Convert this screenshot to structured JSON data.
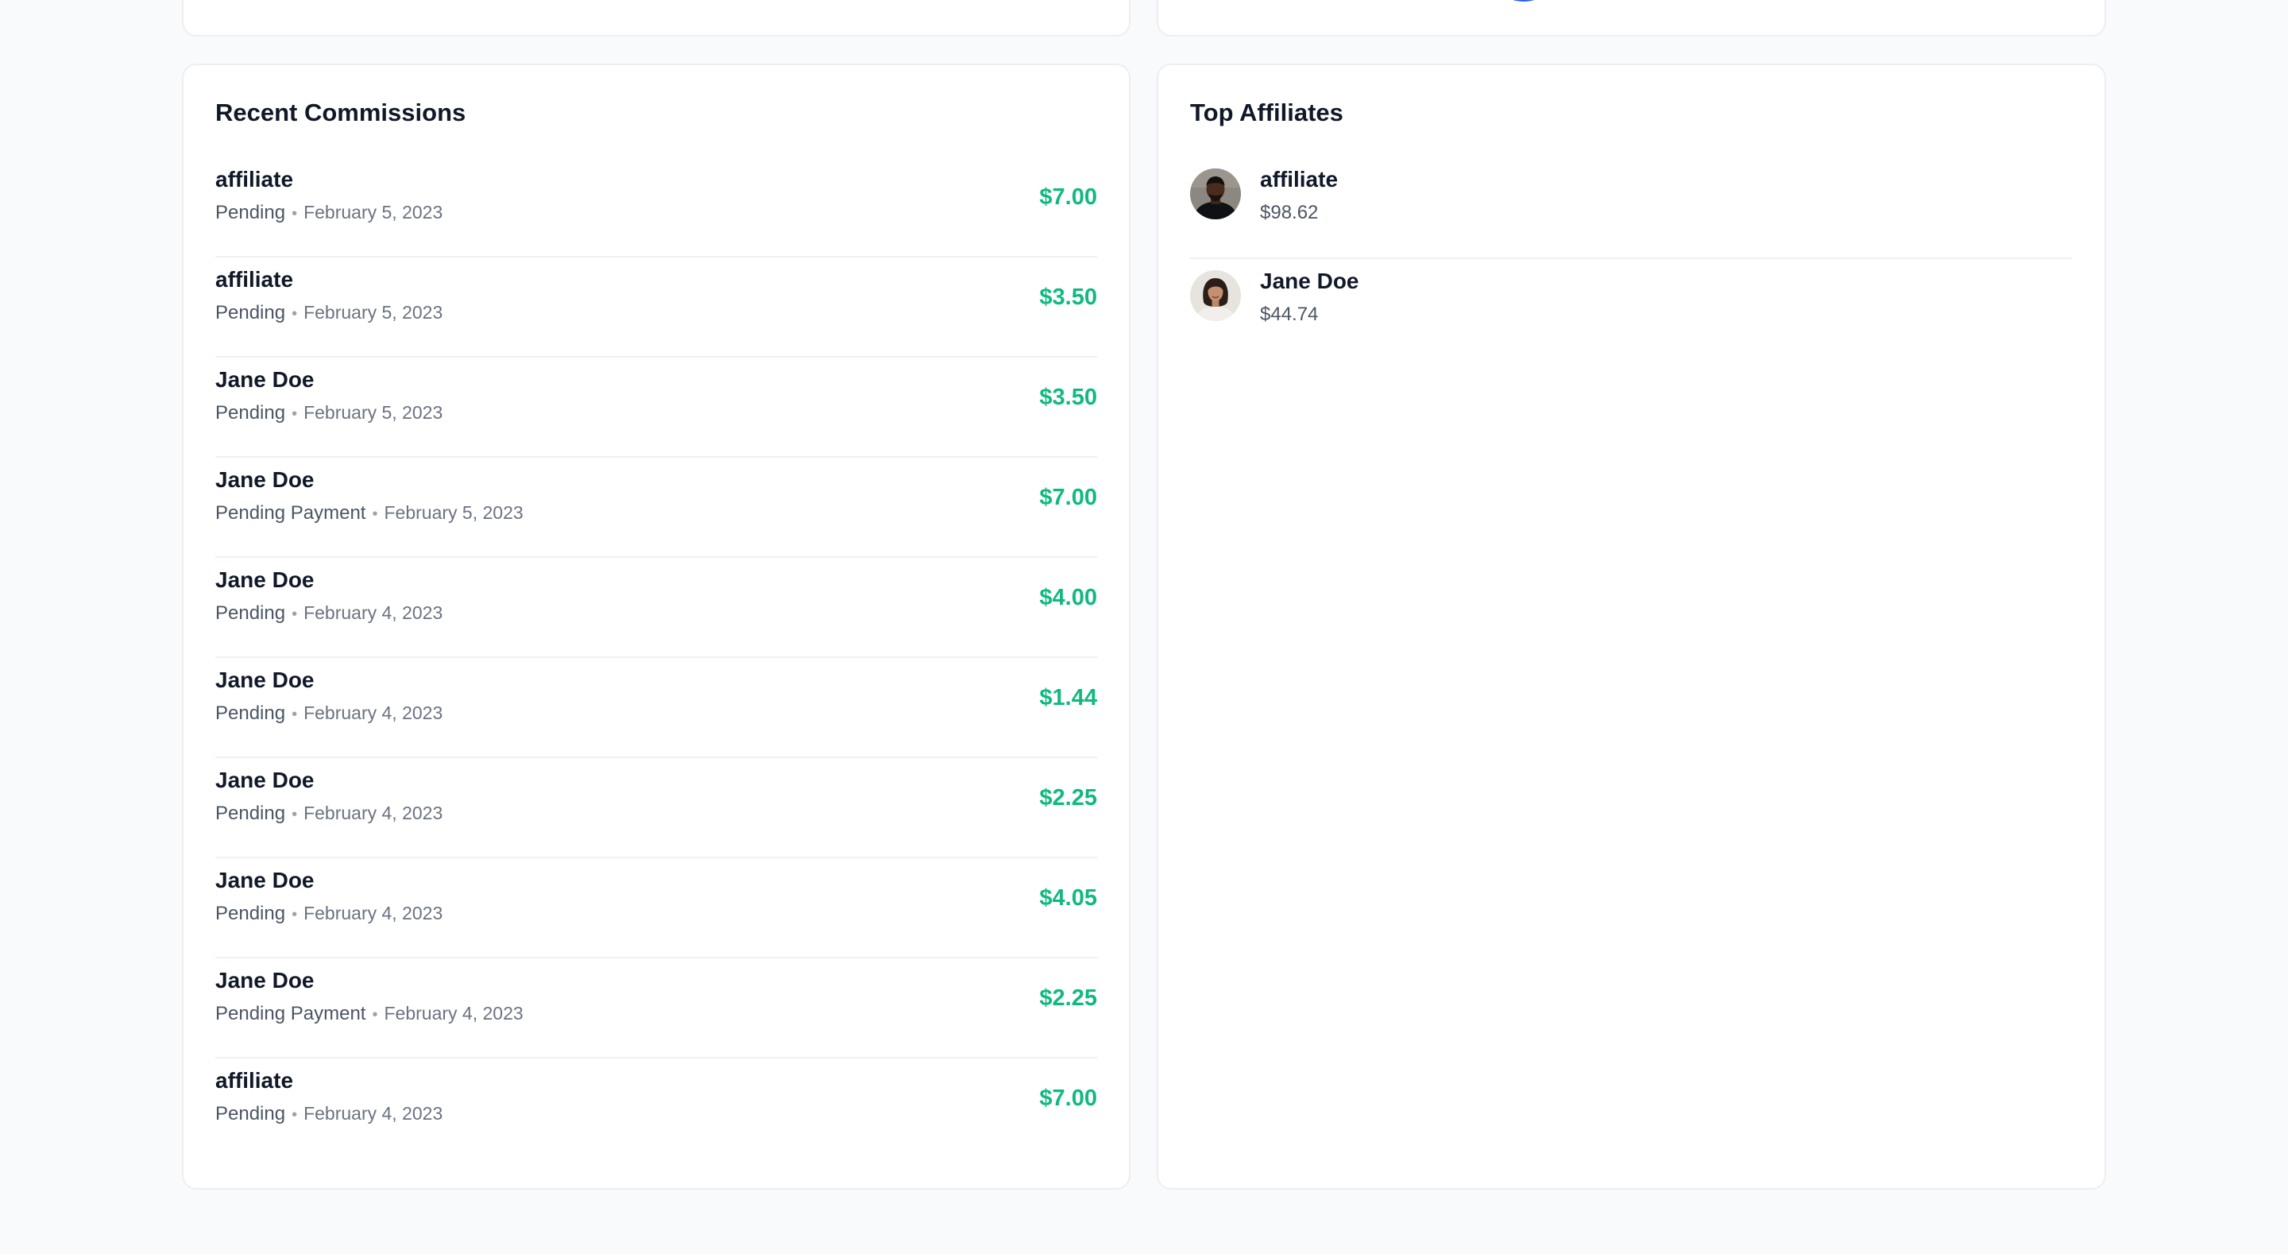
{
  "recent_commissions": {
    "title": "Recent Commissions",
    "items": [
      {
        "name": "affiliate",
        "status": "Pending",
        "date": "February 5, 2023",
        "amount": "$7.00"
      },
      {
        "name": "affiliate",
        "status": "Pending",
        "date": "February 5, 2023",
        "amount": "$3.50"
      },
      {
        "name": "Jane Doe",
        "status": "Pending",
        "date": "February 5, 2023",
        "amount": "$3.50"
      },
      {
        "name": "Jane Doe",
        "status": "Pending Payment",
        "date": "February 5, 2023",
        "amount": "$7.00"
      },
      {
        "name": "Jane Doe",
        "status": "Pending",
        "date": "February 4, 2023",
        "amount": "$4.00"
      },
      {
        "name": "Jane Doe",
        "status": "Pending",
        "date": "February 4, 2023",
        "amount": "$1.44"
      },
      {
        "name": "Jane Doe",
        "status": "Pending",
        "date": "February 4, 2023",
        "amount": "$2.25"
      },
      {
        "name": "Jane Doe",
        "status": "Pending",
        "date": "February 4, 2023",
        "amount": "$4.05"
      },
      {
        "name": "Jane Doe",
        "status": "Pending Payment",
        "date": "February 4, 2023",
        "amount": "$2.25"
      },
      {
        "name": "affiliate",
        "status": "Pending",
        "date": "February 4, 2023",
        "amount": "$7.00"
      }
    ]
  },
  "top_affiliates": {
    "title": "Top Affiliates",
    "items": [
      {
        "name": "affiliate",
        "amount": "$98.62",
        "avatar": "avatar-man-icon"
      },
      {
        "name": "Jane Doe",
        "amount": "$44.74",
        "avatar": "avatar-woman-icon"
      }
    ]
  },
  "colors": {
    "amount": "#10b981",
    "chart_arc": "#2563eb",
    "page_bg": "#f8fafc"
  }
}
